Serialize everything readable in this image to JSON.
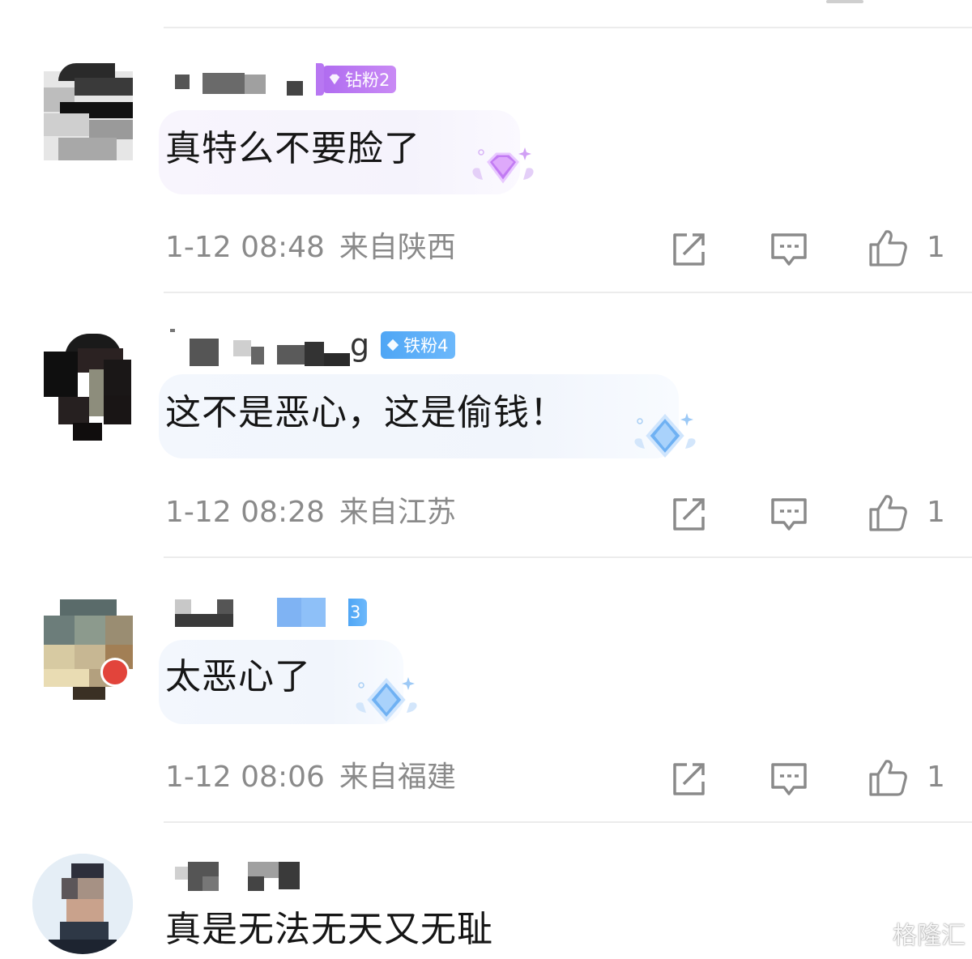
{
  "comments": [
    {
      "badge": "钻粉2",
      "badge_color": "#b06cf0",
      "text": "真特么不要脸了",
      "time": "1-12 08:48",
      "location": "来自陕西",
      "likes": "1"
    },
    {
      "name_tail": "g",
      "badge": "铁粉4",
      "badge_color": "#4fa6f5",
      "text": "这不是恶心，这是偷钱！",
      "time": "1-12 08:28",
      "location": "来自江苏",
      "likes": "1"
    },
    {
      "badge": "3",
      "badge_color": "#6cb8fb",
      "text": "太恶心了",
      "time": "1-12 08:06",
      "location": "来自福建",
      "likes": "1"
    },
    {
      "text": "真是无法无天又无耻"
    }
  ],
  "watermark": {
    "text": "格隆汇"
  },
  "icons": {
    "share": "share-icon",
    "reply": "comment-icon",
    "like": "thumbs-up-icon"
  },
  "colors": {
    "meta_text": "#8a8a8a",
    "divider": "#ececec"
  }
}
